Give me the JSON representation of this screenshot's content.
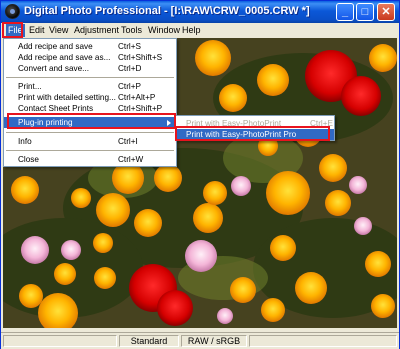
{
  "window": {
    "title": "Digital Photo Professional - [I:\\RAW\\CRW_0005.CRW *]",
    "buttons": {
      "minimize": "_",
      "maximize": "□",
      "close": "✕"
    }
  },
  "menubar": {
    "items": [
      "File",
      "Edit",
      "View",
      "Adjustment",
      "Tools",
      "Window",
      "Help"
    ]
  },
  "file_menu": {
    "items": [
      {
        "label": "Add recipe and save",
        "shortcut": "Ctrl+S"
      },
      {
        "label": "Add recipe and save as...",
        "shortcut": "Ctrl+Shift+S"
      },
      {
        "label": "Convert and save...",
        "shortcut": "Ctrl+D"
      },
      {
        "label": "Print...",
        "shortcut": "Ctrl+P"
      },
      {
        "label": "Print with detailed setting...",
        "shortcut": "Ctrl+Alt+P"
      },
      {
        "label": "Contact Sheet Prints",
        "shortcut": "Ctrl+Shift+P"
      },
      {
        "label": "Plug-in printing",
        "shortcut": ""
      },
      {
        "label": "Info",
        "shortcut": "Ctrl+I"
      },
      {
        "label": "Close",
        "shortcut": "Ctrl+W"
      }
    ]
  },
  "plugin_submenu": {
    "items": [
      {
        "label": "Print with Easy-PhotoPrint",
        "shortcut": "Ctrl+E",
        "enabled": false
      },
      {
        "label": "Print with Easy-PhotoPrint Pro",
        "shortcut": "",
        "enabled": true
      }
    ]
  },
  "statusbar": {
    "cells": [
      "",
      "Standard",
      "RAW / sRGB",
      ""
    ]
  },
  "colors": {
    "titlebar": "#0a4fc8",
    "highlight": "#316ac5",
    "callout": "#e8141e"
  },
  "icons": {
    "app": "camera-lens-icon",
    "submenu_arrow": "chevron-right-icon"
  }
}
